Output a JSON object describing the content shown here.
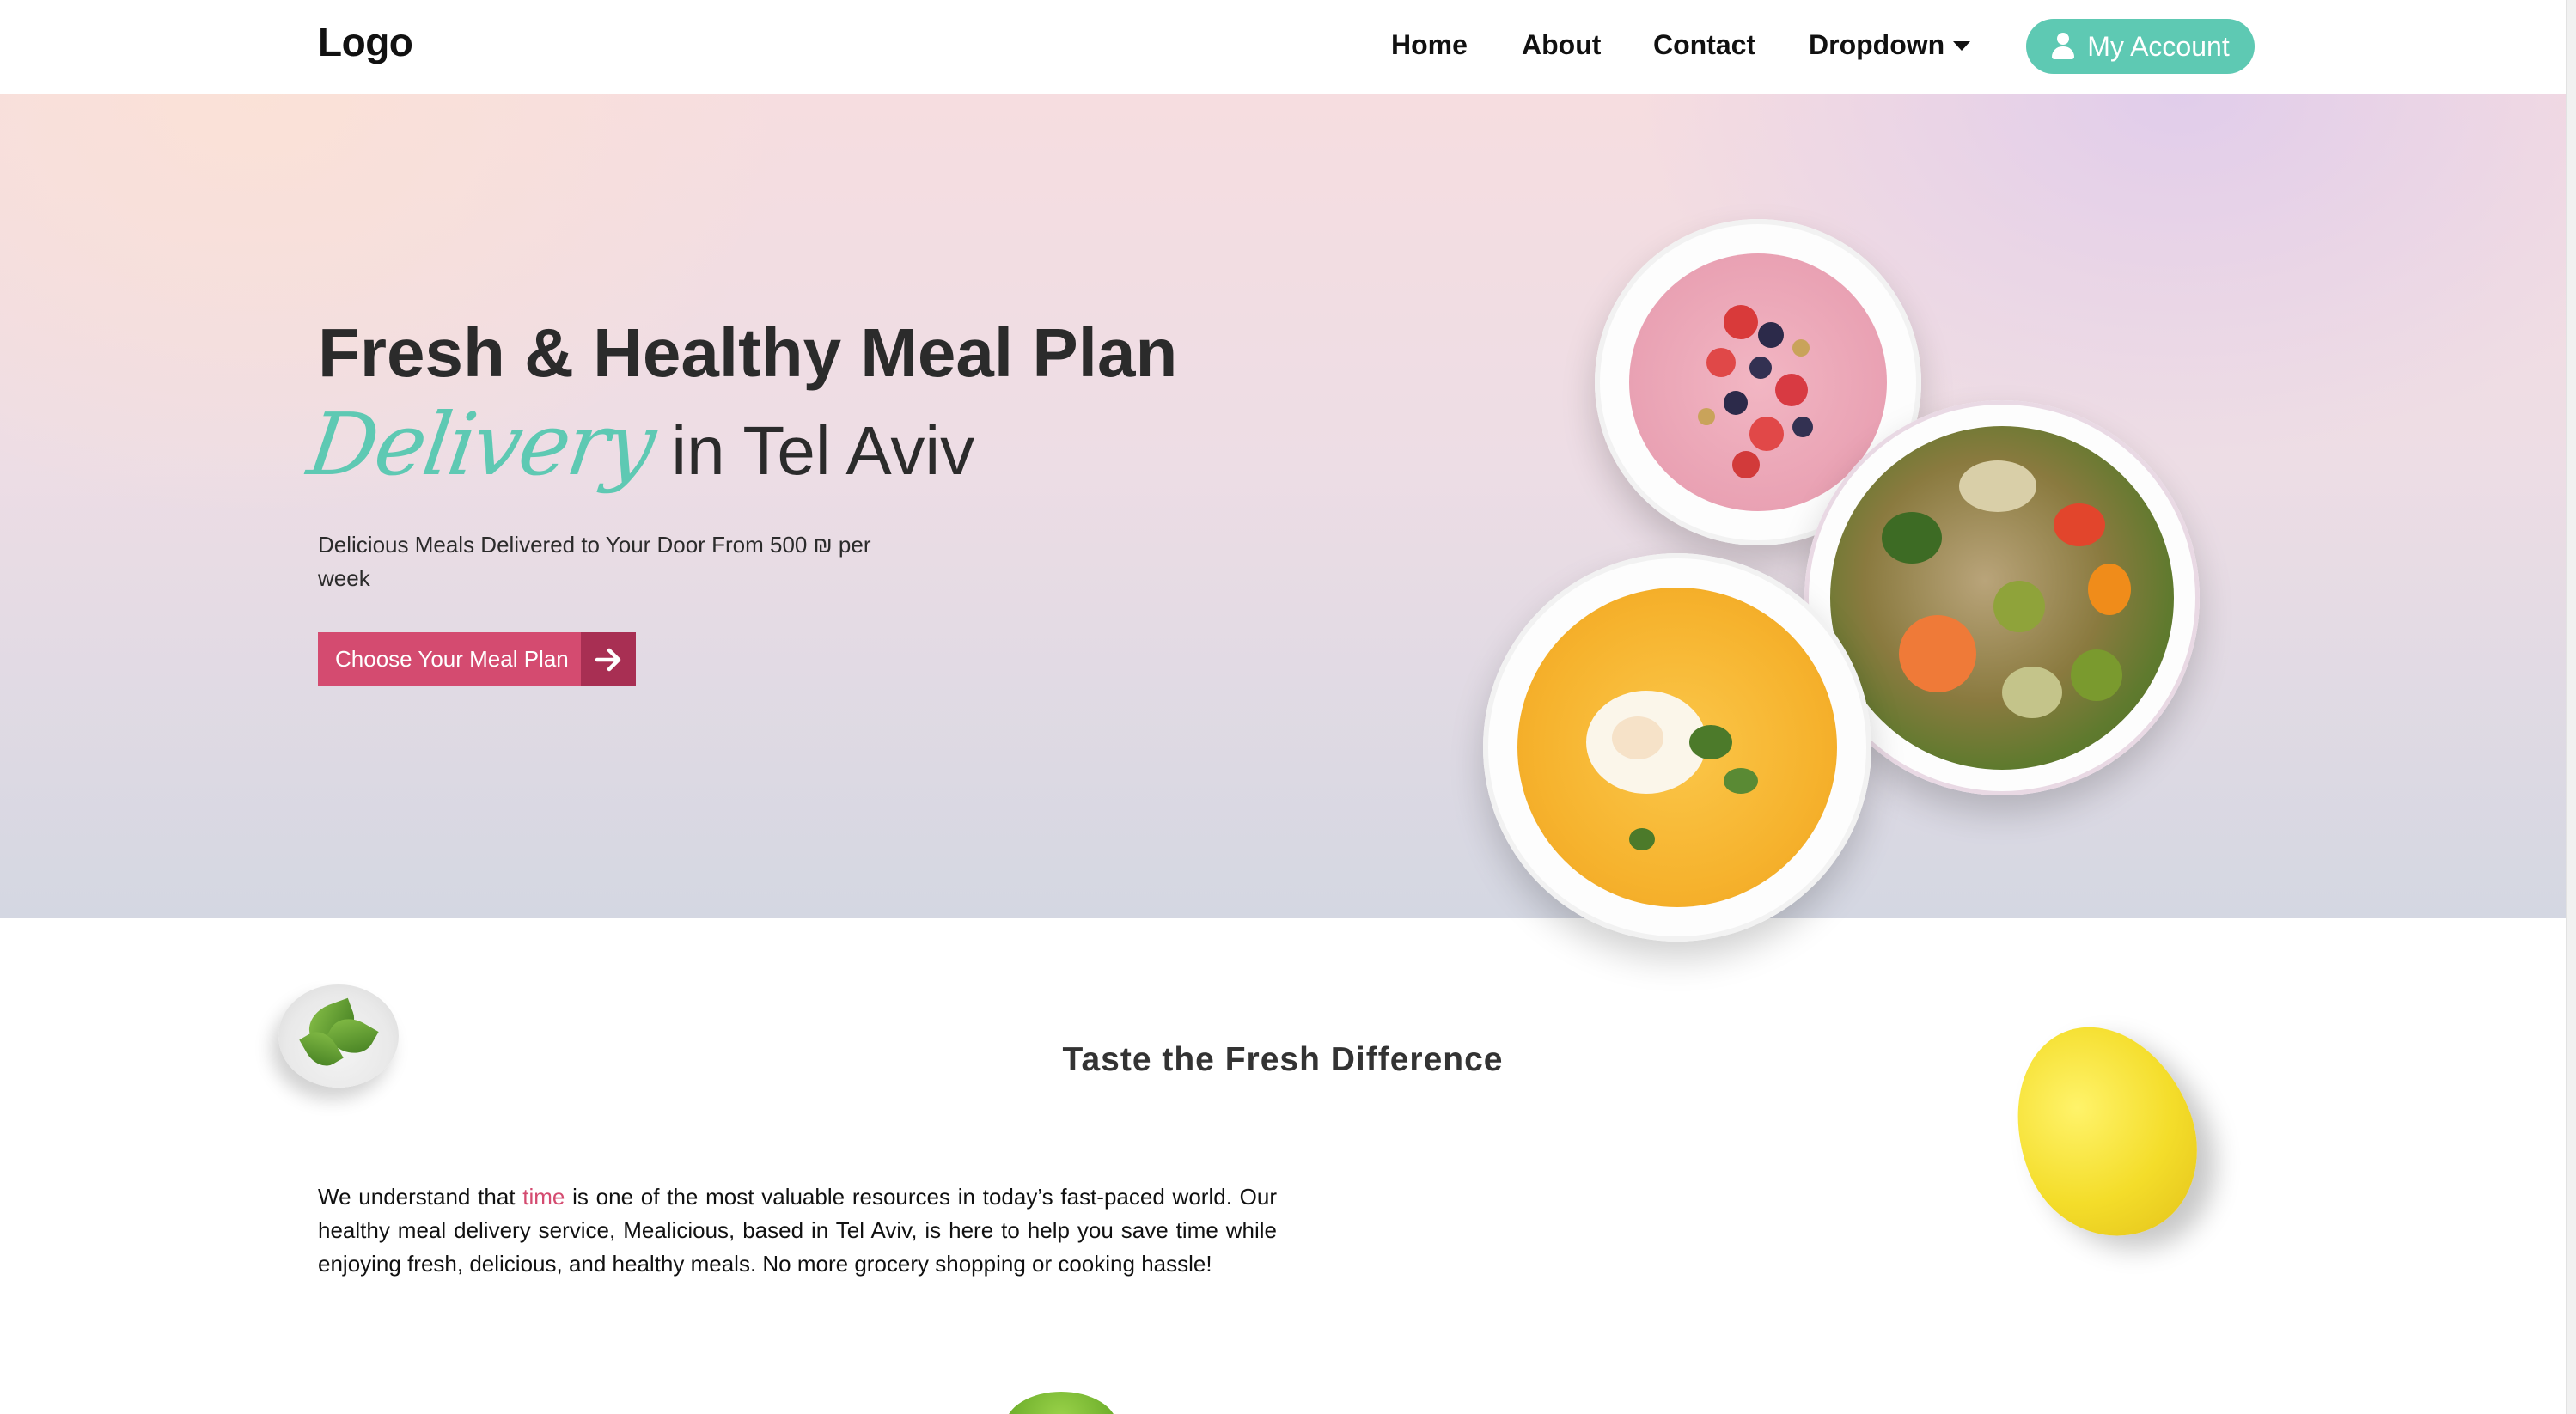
{
  "navbar": {
    "logo": "Logo",
    "links": [
      "Home",
      "About",
      "Contact"
    ],
    "dropdown_label": "Dropdown",
    "account_label": "My Account"
  },
  "hero": {
    "title_line1": "Fresh & Healthy Meal Plan",
    "title_script": "Delivery",
    "title_line2_rest": "in Tel Aviv",
    "subtitle": "Delicious Meals Delivered to Your Door From 500 ₪ per week",
    "cta_label": "Choose Your Meal Plan"
  },
  "section": {
    "title": "Taste the Fresh Difference",
    "body_before": "We understand that ",
    "body_highlight": "time",
    "body_after": " is one of the most valuable resources in today’s fast-paced world. Our healthy meal delivery service, Mealicious, based in Tel Aviv, is here to help you save time while enjoying fresh, delicious, and healthy meals. No more grocery shopping or cooking hassle!"
  },
  "colors": {
    "accent_teal": "#5ec9b3",
    "cta_pink": "#d44b70",
    "cta_dark": "#a82f53"
  },
  "icons": {
    "account": "user-icon",
    "dropdown": "caret-down-icon",
    "cta": "arrow-right-icon"
  }
}
